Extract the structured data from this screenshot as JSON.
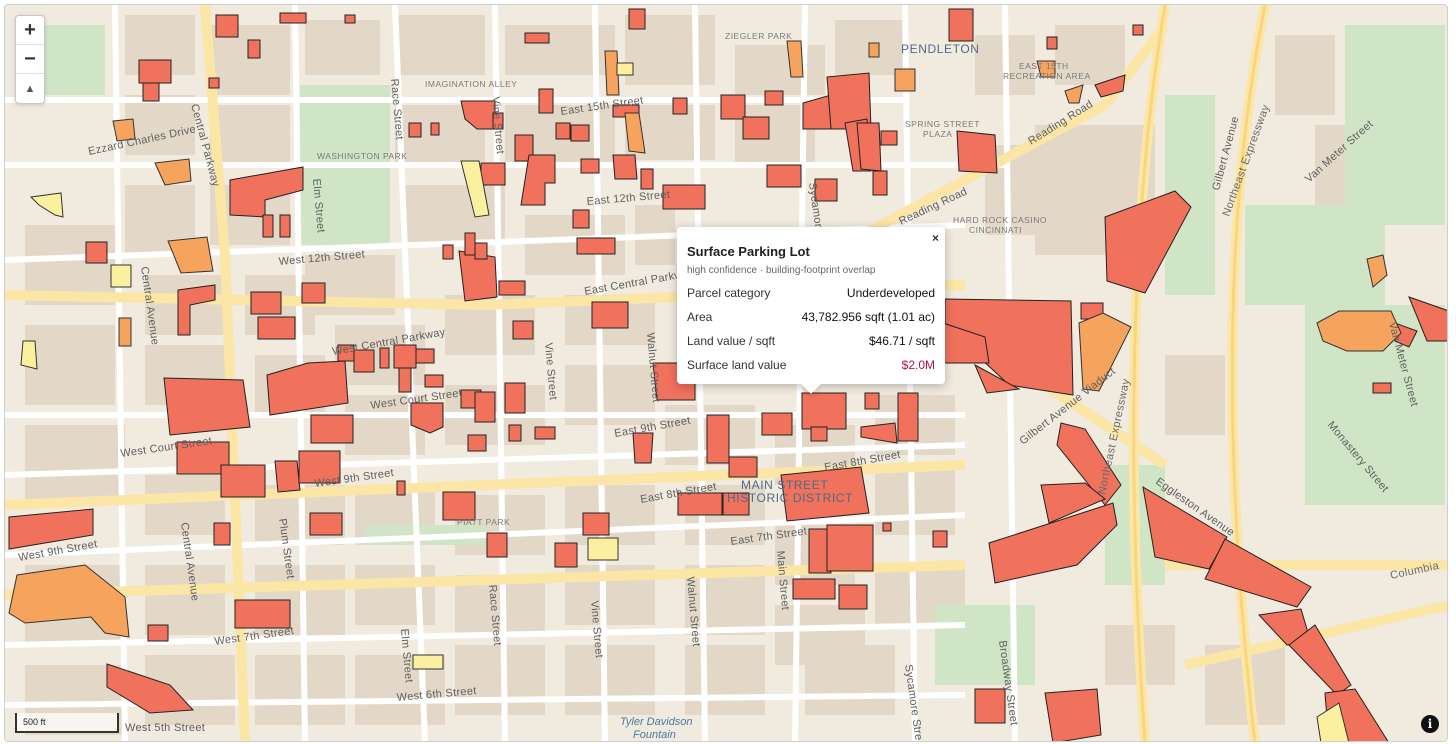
{
  "map": {
    "neighborhoods": {
      "pendleton": "PENDLETON",
      "main_street": "MAIN STREET",
      "historic_district": "HISTORIC DISTRICT"
    },
    "places": {
      "ziegler_park": "ZIEGLER PARK",
      "imagination_alley": "IMAGINATION ALLEY",
      "washington_park": "WASHINGTON PARK",
      "east_15th_recreation": "EAST 15TH",
      "recreation_area": "RECREATION AREA",
      "spring_street": "SPRING STREET",
      "plaza": "PLAZA",
      "hard_rock": "HARD ROCK CASINO",
      "cincinnati": "CINCINNATI",
      "piatt_park": "PIATT PARK"
    },
    "water": {
      "fountain_1": "Tyler Davidson",
      "fountain_2": "Fountain"
    },
    "streets": {
      "ezzard_charles": "Ezzard Charles Drive",
      "central_parkway": "Central Parkway",
      "race_street": "Race Street",
      "vine_street_n": "Vine Street",
      "east_15th": "East 15th Street",
      "east_12th": "East 12th Street",
      "elm_street_n": "Elm Street",
      "west_12th": "West 12th Street",
      "central_avenue": "Central Avenue",
      "east_central_parkway": "East Central Parkway",
      "west_central_parkway": "West Central Parkway",
      "west_court": "West Court Street",
      "west_court_2": "West Court Street",
      "west_9th": "West 9th Street",
      "west_9th_2": "West 9th Street",
      "vine_street_s": "Vine Street",
      "walnut_street_n": "Walnut Street",
      "east_9th": "East 9th Street",
      "east_8th": "East 8th Street",
      "east_8th_2": "East 8th Street",
      "east_7th": "East 7th Street",
      "central_avenue_s": "Central Avenue",
      "plum_street": "Plum Street",
      "race_street_s": "Race Street",
      "vine_street_s2": "Vine Street",
      "walnut_street_s": "Walnut Street",
      "main_street": "Main Street",
      "elm_street_s": "Elm Street",
      "west_7th": "West 7th Street",
      "west_6th": "West 6th Street",
      "west_5th": "West 5th Street",
      "sycamore_n": "Sycamore",
      "sycamore_s": "Sycamore Street",
      "broadway": "Broadway Street",
      "reading_road": "Reading Road",
      "reading_road_2": "Reading Road",
      "gilbert_avenue": "Gilbert Avenue",
      "gilbert_viaduct": "Gilbert Avenue Viaduct",
      "northeast_expressway": "Northeast Expressway",
      "northeast_expressway_s": "Northeast Expressway",
      "van_meter": "Van Meter Street",
      "van_meter_2": "Van Meter Street",
      "monastery": "Monastery Street",
      "eggleston": "Eggleston Avenue",
      "columbia": "Columbia",
      "sycamore_st_n": "Sycamore"
    }
  },
  "controls": {
    "zoom_in": "+",
    "zoom_out": "−",
    "compass": "▲"
  },
  "popup": {
    "close": "×",
    "title": "Surface Parking Lot",
    "subtitle": "high confidence · building-footprint overlap",
    "rows": [
      {
        "label": "Parcel category",
        "value": "Underdeveloped"
      },
      {
        "label": "Area",
        "value": "43,782.956 sqft (1.01 ac)"
      },
      {
        "label": "Land value / sqft",
        "value": "$46.71 / sqft"
      },
      {
        "label": "Surface land value",
        "value": "$2.0M"
      }
    ]
  },
  "scale": {
    "label": "500 ft"
  },
  "attribution": {
    "icon": "i"
  },
  "colors": {
    "parcel_red": "#f0715c",
    "parcel_orange": "#f6a35e",
    "parcel_yellow": "#fbf0a0",
    "money": "#b0124a"
  }
}
